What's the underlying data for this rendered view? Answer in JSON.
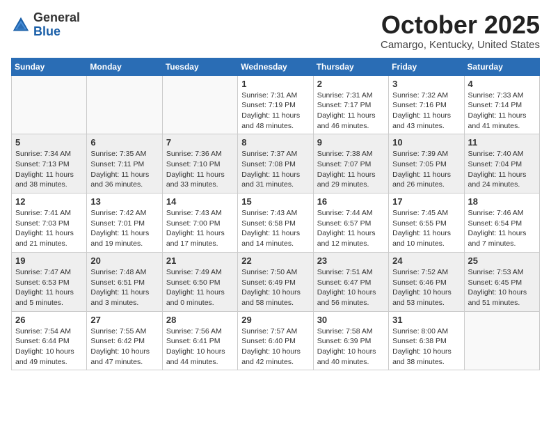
{
  "header": {
    "logo_general": "General",
    "logo_blue": "Blue",
    "month_title": "October 2025",
    "location": "Camargo, Kentucky, United States"
  },
  "days_of_week": [
    "Sunday",
    "Monday",
    "Tuesday",
    "Wednesday",
    "Thursday",
    "Friday",
    "Saturday"
  ],
  "weeks": [
    [
      {
        "day": "",
        "info": ""
      },
      {
        "day": "",
        "info": ""
      },
      {
        "day": "",
        "info": ""
      },
      {
        "day": "1",
        "info": "Sunrise: 7:31 AM\nSunset: 7:19 PM\nDaylight: 11 hours and 48 minutes."
      },
      {
        "day": "2",
        "info": "Sunrise: 7:31 AM\nSunset: 7:17 PM\nDaylight: 11 hours and 46 minutes."
      },
      {
        "day": "3",
        "info": "Sunrise: 7:32 AM\nSunset: 7:16 PM\nDaylight: 11 hours and 43 minutes."
      },
      {
        "day": "4",
        "info": "Sunrise: 7:33 AM\nSunset: 7:14 PM\nDaylight: 11 hours and 41 minutes."
      }
    ],
    [
      {
        "day": "5",
        "info": "Sunrise: 7:34 AM\nSunset: 7:13 PM\nDaylight: 11 hours and 38 minutes."
      },
      {
        "day": "6",
        "info": "Sunrise: 7:35 AM\nSunset: 7:11 PM\nDaylight: 11 hours and 36 minutes."
      },
      {
        "day": "7",
        "info": "Sunrise: 7:36 AM\nSunset: 7:10 PM\nDaylight: 11 hours and 33 minutes."
      },
      {
        "day": "8",
        "info": "Sunrise: 7:37 AM\nSunset: 7:08 PM\nDaylight: 11 hours and 31 minutes."
      },
      {
        "day": "9",
        "info": "Sunrise: 7:38 AM\nSunset: 7:07 PM\nDaylight: 11 hours and 29 minutes."
      },
      {
        "day": "10",
        "info": "Sunrise: 7:39 AM\nSunset: 7:05 PM\nDaylight: 11 hours and 26 minutes."
      },
      {
        "day": "11",
        "info": "Sunrise: 7:40 AM\nSunset: 7:04 PM\nDaylight: 11 hours and 24 minutes."
      }
    ],
    [
      {
        "day": "12",
        "info": "Sunrise: 7:41 AM\nSunset: 7:03 PM\nDaylight: 11 hours and 21 minutes."
      },
      {
        "day": "13",
        "info": "Sunrise: 7:42 AM\nSunset: 7:01 PM\nDaylight: 11 hours and 19 minutes."
      },
      {
        "day": "14",
        "info": "Sunrise: 7:43 AM\nSunset: 7:00 PM\nDaylight: 11 hours and 17 minutes."
      },
      {
        "day": "15",
        "info": "Sunrise: 7:43 AM\nSunset: 6:58 PM\nDaylight: 11 hours and 14 minutes."
      },
      {
        "day": "16",
        "info": "Sunrise: 7:44 AM\nSunset: 6:57 PM\nDaylight: 11 hours and 12 minutes."
      },
      {
        "day": "17",
        "info": "Sunrise: 7:45 AM\nSunset: 6:55 PM\nDaylight: 11 hours and 10 minutes."
      },
      {
        "day": "18",
        "info": "Sunrise: 7:46 AM\nSunset: 6:54 PM\nDaylight: 11 hours and 7 minutes."
      }
    ],
    [
      {
        "day": "19",
        "info": "Sunrise: 7:47 AM\nSunset: 6:53 PM\nDaylight: 11 hours and 5 minutes."
      },
      {
        "day": "20",
        "info": "Sunrise: 7:48 AM\nSunset: 6:51 PM\nDaylight: 11 hours and 3 minutes."
      },
      {
        "day": "21",
        "info": "Sunrise: 7:49 AM\nSunset: 6:50 PM\nDaylight: 11 hours and 0 minutes."
      },
      {
        "day": "22",
        "info": "Sunrise: 7:50 AM\nSunset: 6:49 PM\nDaylight: 10 hours and 58 minutes."
      },
      {
        "day": "23",
        "info": "Sunrise: 7:51 AM\nSunset: 6:47 PM\nDaylight: 10 hours and 56 minutes."
      },
      {
        "day": "24",
        "info": "Sunrise: 7:52 AM\nSunset: 6:46 PM\nDaylight: 10 hours and 53 minutes."
      },
      {
        "day": "25",
        "info": "Sunrise: 7:53 AM\nSunset: 6:45 PM\nDaylight: 10 hours and 51 minutes."
      }
    ],
    [
      {
        "day": "26",
        "info": "Sunrise: 7:54 AM\nSunset: 6:44 PM\nDaylight: 10 hours and 49 minutes."
      },
      {
        "day": "27",
        "info": "Sunrise: 7:55 AM\nSunset: 6:42 PM\nDaylight: 10 hours and 47 minutes."
      },
      {
        "day": "28",
        "info": "Sunrise: 7:56 AM\nSunset: 6:41 PM\nDaylight: 10 hours and 44 minutes."
      },
      {
        "day": "29",
        "info": "Sunrise: 7:57 AM\nSunset: 6:40 PM\nDaylight: 10 hours and 42 minutes."
      },
      {
        "day": "30",
        "info": "Sunrise: 7:58 AM\nSunset: 6:39 PM\nDaylight: 10 hours and 40 minutes."
      },
      {
        "day": "31",
        "info": "Sunrise: 8:00 AM\nSunset: 6:38 PM\nDaylight: 10 hours and 38 minutes."
      },
      {
        "day": "",
        "info": ""
      }
    ]
  ]
}
